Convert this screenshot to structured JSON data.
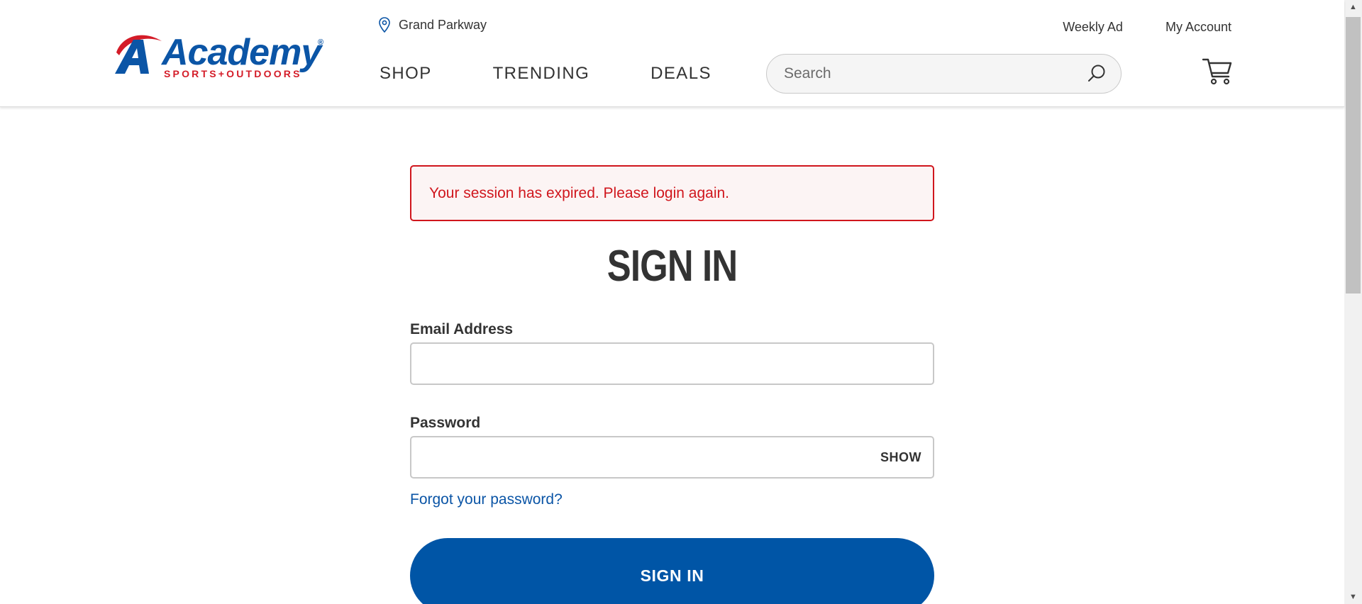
{
  "header": {
    "logo": {
      "word": "Academy",
      "tagline": "SPORTS+OUTDOORS",
      "reg_mark": "®",
      "brand_blue": "#0b55a6",
      "brand_red": "#d41c28"
    },
    "store": {
      "icon": "location-pin-icon",
      "label": "Grand Parkway"
    },
    "top_links": {
      "weekly_ad": "Weekly Ad",
      "my_account": "My Account"
    },
    "nav": {
      "shop": "SHOP",
      "trending": "TRENDING",
      "deals": "DEALS"
    },
    "search": {
      "placeholder": "Search",
      "value": "",
      "icon": "search-icon"
    },
    "cart": {
      "icon": "cart-icon"
    }
  },
  "main": {
    "alert": {
      "message": "Your session has expired. Please login again.",
      "color": "#d0161d"
    },
    "title": "SIGN IN",
    "email": {
      "label": "Email Address",
      "value": ""
    },
    "password": {
      "label": "Password",
      "value": "",
      "show_label": "SHOW"
    },
    "forgot_link": "Forgot your password?",
    "submit_label": "SIGN IN",
    "accent": "#0055a6"
  },
  "scrollbar": {
    "up_icon": "scroll-up-arrow-icon",
    "down_icon": "scroll-down-arrow-icon"
  }
}
